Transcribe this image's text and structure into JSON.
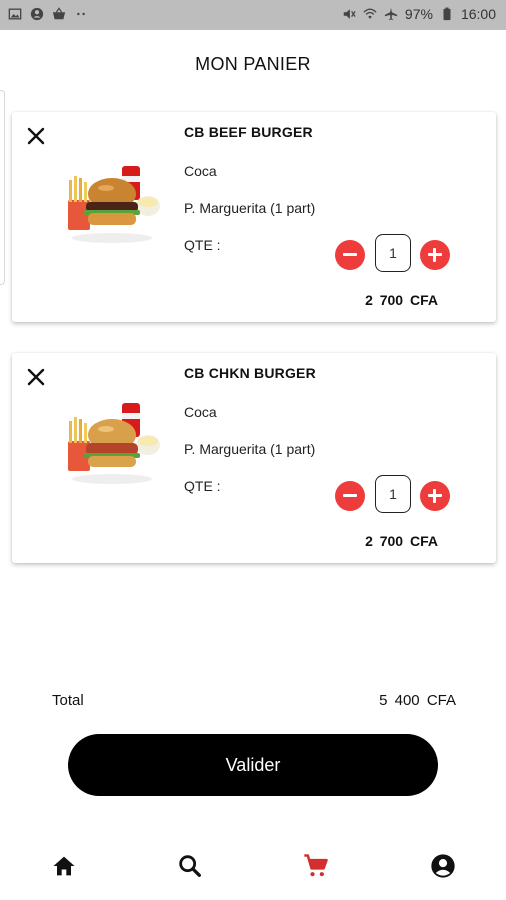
{
  "status_bar": {
    "battery": "97%",
    "time": "16:00",
    "left_icons": [
      "image-icon",
      "account-circle-icon",
      "basket-icon",
      "more-dots-icon"
    ],
    "right_icons": [
      "mute-icon",
      "wifi-icon",
      "airplane-icon",
      "battery-icon"
    ]
  },
  "header": {
    "title": "MON PANIER"
  },
  "cart": {
    "items": [
      {
        "name": "CB BEEF BURGER",
        "option1": "Coca",
        "option2": "P. Marguerita (1 part)",
        "qty_label": "QTE  :",
        "quantity": "1",
        "price": "2 700  CFA"
      },
      {
        "name": "CB CHKN BURGER",
        "option1": "Coca",
        "option2": "P. Marguerita (1 part)",
        "qty_label": "QTE  :",
        "quantity": "1",
        "price": "2 700  CFA"
      }
    ]
  },
  "summary": {
    "total_label": "Total",
    "total_value": "5 400  CFA"
  },
  "actions": {
    "validate_label": "Valider"
  },
  "colors": {
    "accent": "#ee3b3b",
    "nav_active": "#d32f2f",
    "button_bg": "#000000",
    "status_bar": "#bdbdbd"
  },
  "bottom_nav": {
    "items": [
      "home-icon",
      "search-icon",
      "cart-icon",
      "account-icon"
    ],
    "active": "cart-icon"
  }
}
